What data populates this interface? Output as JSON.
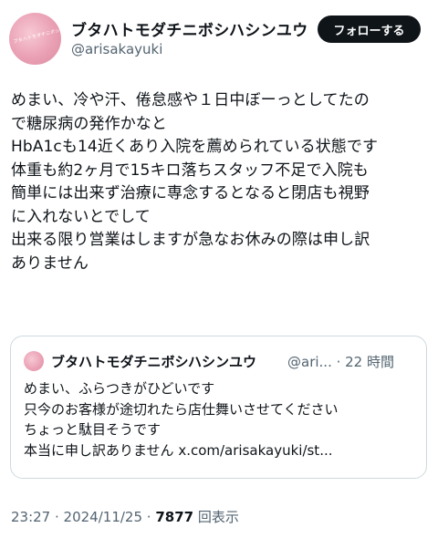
{
  "author": {
    "display_name": "ブタハトモダチニボシハシンユウ",
    "handle": "@arisakayuki",
    "avatar_text": "ブタハトモダチニボシハシンユウ"
  },
  "follow_button_label": "フォローする",
  "tweet_lines": [
    "めまい、冷や汗、倦怠感や１日中ぼーっとしてたの",
    "で糖尿病の発作かなと",
    "HbA1cも14近くあり入院を薦められている状態です",
    "体重も約2ヶ月で15キロ落ちスタッフ不足で入院も",
    "簡単には出来ず治療に専念するとなると閉店も視野",
    "に入れないとでして",
    "出来る限り営業はしますが急なお休みの際は申し訳",
    "ありません"
  ],
  "quoted_tweet": {
    "display_name": "ブタハトモダチニボシハシンユウ",
    "handle_time": "@ari... · 22 時間",
    "lines": [
      "めまい、ふらつきがひどいです",
      "只今のお客様が途切れたら店仕舞いさせてください",
      "ちょっと駄目そうです",
      "本当に申し訳ありません x.com/arisakayuki/st..."
    ]
  },
  "meta": {
    "time": "23:27",
    "separator": " · ",
    "date": "2024/11/25",
    "separator2": " · ",
    "views": "7877",
    "views_label": " 回表示"
  },
  "colors": {
    "text": "#0f1419",
    "secondary": "#536471",
    "border": "#cfd9de",
    "button_bg": "#0f1419"
  }
}
